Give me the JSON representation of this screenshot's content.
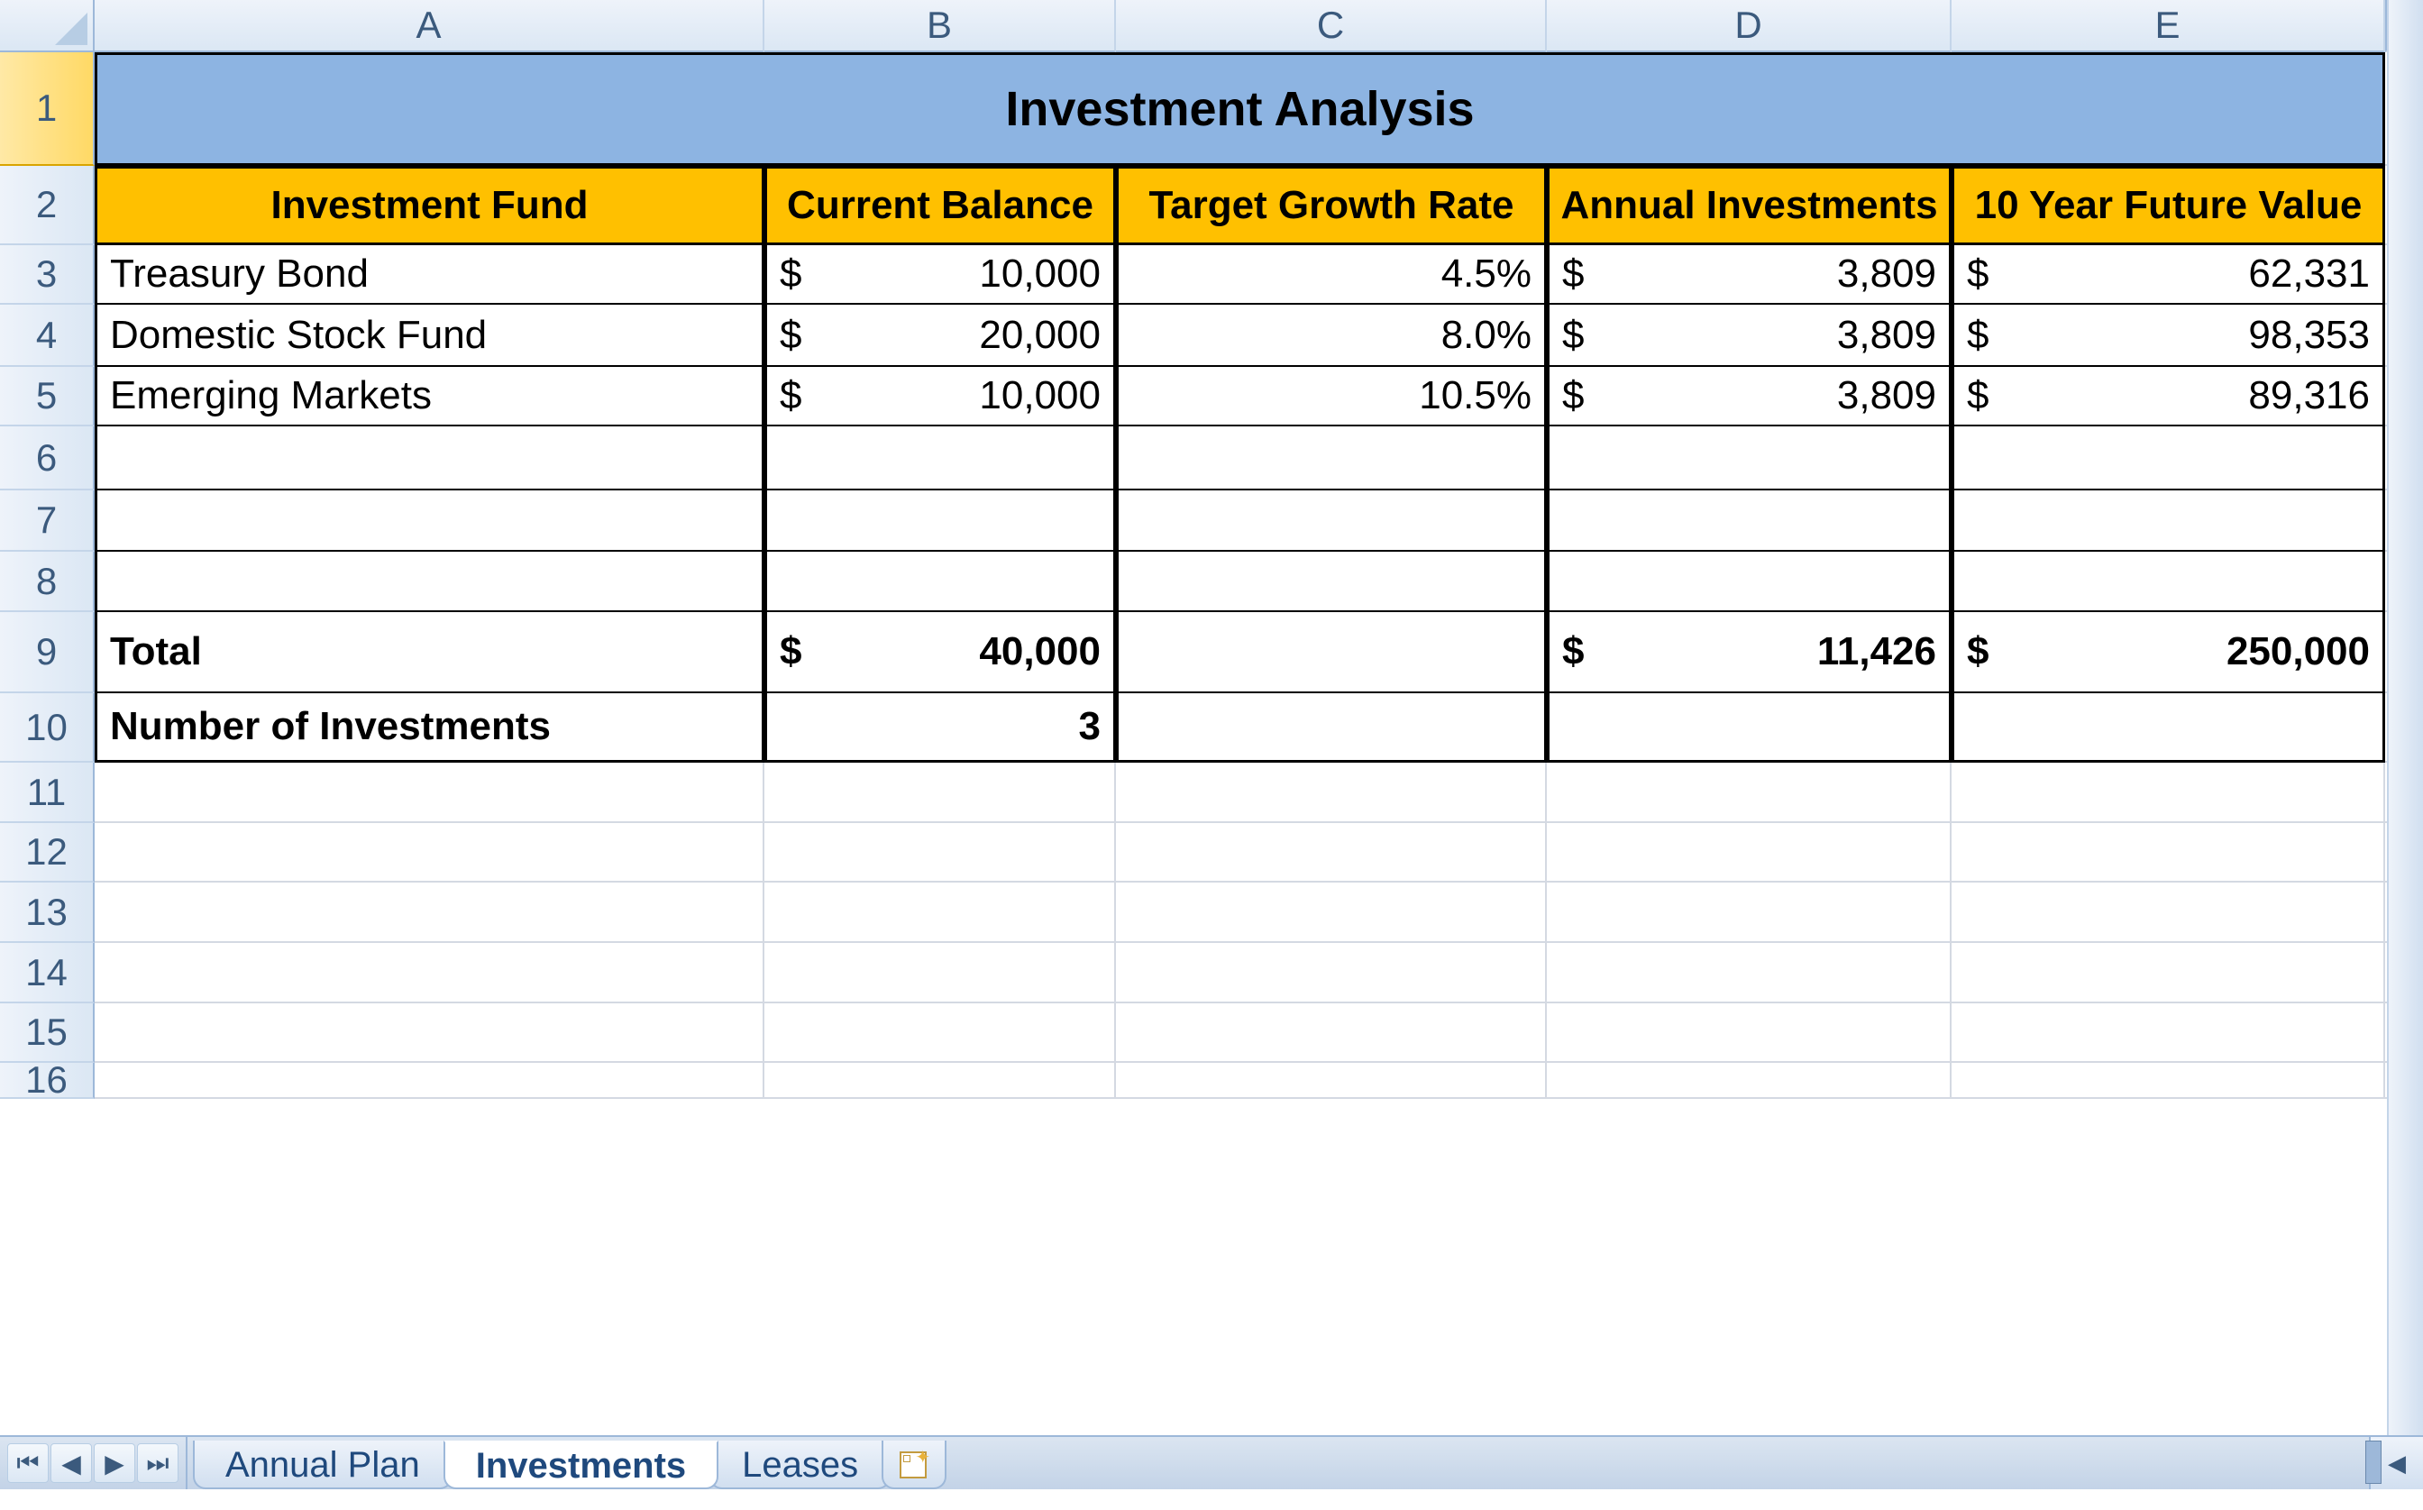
{
  "columns": [
    "A",
    "B",
    "C",
    "D",
    "E"
  ],
  "rows": [
    "1",
    "2",
    "3",
    "4",
    "5",
    "6",
    "7",
    "8",
    "9",
    "10",
    "11",
    "12",
    "13",
    "14",
    "15",
    "16"
  ],
  "title": "Investment Analysis",
  "headers": {
    "a": "Investment Fund",
    "b": "Current Balance",
    "c": "Target Growth Rate",
    "d": "Annual Investments",
    "e": "10 Year Future Value"
  },
  "data": {
    "r3": {
      "fund": "Treasury Bond",
      "balance": "10,000",
      "rate": "4.5%",
      "annual": "3,809",
      "fv": "62,331"
    },
    "r4": {
      "fund": "Domestic Stock Fund",
      "balance": "20,000",
      "rate": "8.0%",
      "annual": "3,809",
      "fv": "98,353"
    },
    "r5": {
      "fund": "Emerging Markets",
      "balance": "10,000",
      "rate": "10.5%",
      "annual": "3,809",
      "fv": "89,316"
    }
  },
  "totals": {
    "label": "Total",
    "balance": "40,000",
    "annual": "11,426",
    "fv": "250,000"
  },
  "count": {
    "label": "Number of Investments",
    "value": "3"
  },
  "currency": "$",
  "tabs": {
    "t1": "Annual Plan",
    "t2": "Investments",
    "t3": "Leases"
  }
}
